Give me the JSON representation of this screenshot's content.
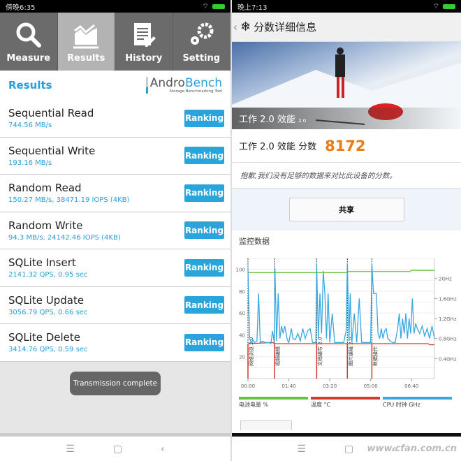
{
  "left": {
    "status_time": "傍晚6:35",
    "tabs": [
      {
        "label": "Measure",
        "icon": "search-icon"
      },
      {
        "label": "Results",
        "icon": "chart-icon",
        "selected": true
      },
      {
        "label": "History",
        "icon": "document-icon"
      },
      {
        "label": "Setting",
        "icon": "gears-icon"
      }
    ],
    "header_title": "Results",
    "logo": {
      "name_a": "Andro",
      "name_b": "Bench",
      "tagline": "Storage Benchmarking Tool"
    },
    "ranking_label": "Ranking",
    "results": [
      {
        "name": "Sequential Read",
        "value": "744.56 MB/s"
      },
      {
        "name": "Sequential Write",
        "value": "193.16 MB/s"
      },
      {
        "name": "Random Read",
        "value": "150.27 MB/s, 38471.19 IOPS (4KB)"
      },
      {
        "name": "Random Write",
        "value": "94.3 MB/s, 24142.46 IOPS (4KB)"
      },
      {
        "name": "SQLite Insert",
        "value": "2141.32 QPS, 0.95 sec"
      },
      {
        "name": "SQLite Update",
        "value": "3056.79 QPS, 0.66 sec"
      },
      {
        "name": "SQLite Delete",
        "value": "3414.76 QPS, 0.59 sec"
      }
    ],
    "toast": "Transmission complete"
  },
  "right": {
    "status_time": "晚上7:13",
    "title": "分数详细信息",
    "hero_label": "工作 2.0 效能",
    "hero_badge": "2.0",
    "score_label": "工作 2.0 效能 分数",
    "score": "8172",
    "message": "抱歉,我们没有足够的数据来对比此设备的分数。",
    "share": "共享",
    "monitor_title": "监控数据",
    "watermark": "www.cfan.com.cn"
  },
  "colors": {
    "accent": "#2aa5dc",
    "score": "#f07a12",
    "battery": "#6cc23a",
    "temperature": "#d23a32",
    "cpu": "#3aa8e0"
  },
  "chart_data": {
    "type": "line",
    "x_ticks": [
      "00:00",
      "01:40",
      "03:20",
      "05:00",
      "06:40"
    ],
    "y_left_ticks": [
      "20",
      "40",
      "60",
      "80",
      "100"
    ],
    "y_right_ticks": [
      "0.4GHz",
      "0.8GHz",
      "1.2GHz",
      "1.6GHz",
      "2GHz"
    ],
    "ylim_left": [
      0,
      110
    ],
    "ylim_right_ghz": [
      0,
      2.4
    ],
    "xlim_seconds": [
      0,
      456
    ],
    "grid": true,
    "legend_placement": "bottom",
    "markers": [
      {
        "t": 0,
        "label": "网络浏览 2.0"
      },
      {
        "t": 65,
        "label": "视频编辑"
      },
      {
        "t": 168,
        "label": "文档编写 2.0"
      },
      {
        "t": 243,
        "label": "图片编辑 2.0"
      },
      {
        "t": 303,
        "label": "数据操作"
      }
    ],
    "series": [
      {
        "name": "电池电量 %",
        "axis": "left",
        "points": [
          [
            0,
            97
          ],
          [
            240,
            97
          ],
          [
            245,
            98
          ],
          [
            395,
            98
          ],
          [
            400,
            99
          ],
          [
            456,
            99
          ]
        ]
      },
      {
        "name": "温度 °C",
        "axis": "left",
        "points": [
          [
            0,
            32
          ],
          [
            2,
            32
          ],
          [
            60,
            33
          ],
          [
            65,
            32
          ],
          [
            440,
            32
          ],
          [
            445,
            31
          ],
          [
            456,
            31
          ]
        ]
      },
      {
        "name": "CPU 时钟 GHz",
        "axis": "right",
        "points": [
          [
            0,
            2.2
          ],
          [
            4,
            0.8
          ],
          [
            8,
            0.72
          ],
          [
            12,
            0.78
          ],
          [
            16,
            0.72
          ],
          [
            22,
            0.75
          ],
          [
            26,
            1.7
          ],
          [
            30,
            0.72
          ],
          [
            36,
            0.75
          ],
          [
            42,
            0.72
          ],
          [
            50,
            0.72
          ],
          [
            56,
            0.7
          ],
          [
            60,
            0.95
          ],
          [
            64,
            0.72
          ],
          [
            66,
            2.2
          ],
          [
            70,
            0.75
          ],
          [
            74,
            1.7
          ],
          [
            78,
            0.8
          ],
          [
            82,
            1.05
          ],
          [
            86,
            0.9
          ],
          [
            90,
            1.05
          ],
          [
            96,
            0.78
          ],
          [
            100,
            0.72
          ],
          [
            106,
            1.0
          ],
          [
            110,
            0.8
          ],
          [
            116,
            0.78
          ],
          [
            122,
            0.9
          ],
          [
            128,
            0.75
          ],
          [
            134,
            1.0
          ],
          [
            140,
            0.8
          ],
          [
            146,
            0.95
          ],
          [
            152,
            1.0
          ],
          [
            158,
            0.72
          ],
          [
            166,
            0.72
          ],
          [
            168,
            2.3
          ],
          [
            172,
            0.8
          ],
          [
            176,
            1.7
          ],
          [
            180,
            0.9
          ],
          [
            184,
            2.15
          ],
          [
            188,
            1.7
          ],
          [
            192,
            0.8
          ],
          [
            196,
            1.7
          ],
          [
            200,
            0.72
          ],
          [
            206,
            1.3
          ],
          [
            212,
            0.72
          ],
          [
            222,
            0.72
          ],
          [
            234,
            0.72
          ],
          [
            240,
            0.95
          ],
          [
            243,
            2.3
          ],
          [
            247,
            0.75
          ],
          [
            250,
            1.7
          ],
          [
            254,
            0.72
          ],
          [
            260,
            1.3
          ],
          [
            266,
            0.72
          ],
          [
            272,
            1.6
          ],
          [
            278,
            0.72
          ],
          [
            290,
            0.72
          ],
          [
            300,
            0.72
          ],
          [
            303,
            2.3
          ],
          [
            307,
            1.7
          ],
          [
            314,
            1.7
          ],
          [
            318,
            0.9
          ],
          [
            322,
            0.8
          ],
          [
            326,
            1.0
          ],
          [
            330,
            0.8
          ],
          [
            334,
            0.95
          ],
          [
            338,
            1.0
          ],
          [
            342,
            0.8
          ],
          [
            348,
            0.75
          ],
          [
            354,
            0.72
          ],
          [
            360,
            0.72
          ],
          [
            366,
            1.0
          ],
          [
            370,
            1.3
          ],
          [
            374,
            0.8
          ],
          [
            378,
            1.2
          ],
          [
            382,
            0.9
          ],
          [
            386,
            1.3
          ],
          [
            390,
            0.8
          ],
          [
            394,
            1.2
          ],
          [
            398,
            0.9
          ],
          [
            402,
            1.6
          ],
          [
            406,
            0.9
          ],
          [
            410,
            1.1
          ],
          [
            414,
            1.0
          ],
          [
            420,
            0.9
          ],
          [
            426,
            1.05
          ],
          [
            432,
            0.85
          ],
          [
            438,
            1.0
          ],
          [
            444,
            0.8
          ],
          [
            450,
            1.05
          ],
          [
            456,
            0.8
          ]
        ]
      }
    ]
  }
}
